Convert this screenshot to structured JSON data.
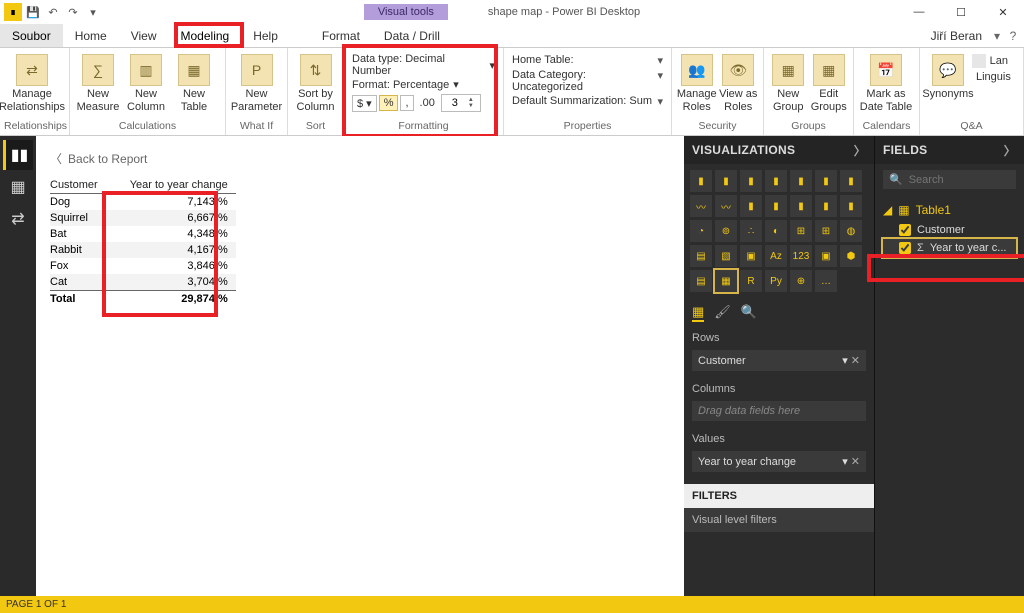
{
  "title": {
    "contextual": "Visual tools",
    "doc": "shape map - Power BI Desktop"
  },
  "menu": {
    "file": "Soubor",
    "tabs": [
      "Home",
      "View",
      "Modeling",
      "Help",
      "Format",
      "Data / Drill"
    ],
    "user": "Jiří Beran"
  },
  "ribbon": {
    "relationships": {
      "manage": "Manage\nRelationships",
      "caption": "Relationships"
    },
    "calculations": {
      "newMeasure": "New\nMeasure",
      "newColumn": "New\nColumn",
      "newTable": "New\nTable",
      "caption": "Calculations"
    },
    "whatif": {
      "newParameter": "New\nParameter",
      "caption": "What If"
    },
    "sort": {
      "sortBy": "Sort by\nColumn",
      "caption": "Sort"
    },
    "formatting": {
      "dataType": "Data type: Decimal Number",
      "format": "Format: Percentage",
      "decimals": "3",
      "caption": "Formatting"
    },
    "properties": {
      "homeTable": "Home Table:",
      "dataCategory": "Data Category: Uncategorized",
      "defaultSummarization": "Default Summarization: Sum",
      "caption": "Properties"
    },
    "security": {
      "manageRoles": "Manage\nRoles",
      "viewAs": "View as\nRoles",
      "caption": "Security"
    },
    "groups": {
      "newGroup": "New\nGroup",
      "editGroups": "Edit\nGroups",
      "caption": "Groups"
    },
    "calendars": {
      "markAs": "Mark as\nDate Table",
      "caption": "Calendars"
    },
    "qna": {
      "syn": "Synonyms",
      "ling": "Linguis",
      "lan": "Lan",
      "caption": "Q&A"
    }
  },
  "canvas": {
    "back": "Back to Report",
    "tableHeaders": [
      "Customer",
      "Year to year change"
    ],
    "rows": [
      {
        "c": "Dog",
        "v": "7,143 %"
      },
      {
        "c": "Squirrel",
        "v": "6,667 %"
      },
      {
        "c": "Bat",
        "v": "4,348 %"
      },
      {
        "c": "Rabbit",
        "v": "4,167 %"
      },
      {
        "c": "Fox",
        "v": "3,846 %"
      },
      {
        "c": "Cat",
        "v": "3,704 %"
      }
    ],
    "total": {
      "label": "Total",
      "v": "29,874 %"
    }
  },
  "viz": {
    "header": "VISUALIZATIONS",
    "rowsLabel": "Rows",
    "rowsWell": "Customer",
    "columnsLabel": "Columns",
    "columnsPlaceholder": "Drag data fields here",
    "valuesLabel": "Values",
    "valuesWell": "Year to year change",
    "filtersHeader": "FILTERS",
    "visualFilters": "Visual level filters"
  },
  "fields": {
    "header": "FIELDS",
    "searchPlaceholder": "Search",
    "table": "Table1",
    "field1": "Customer",
    "field2": "Year to year c..."
  },
  "status": {
    "page": "PAGE 1 OF 1"
  }
}
